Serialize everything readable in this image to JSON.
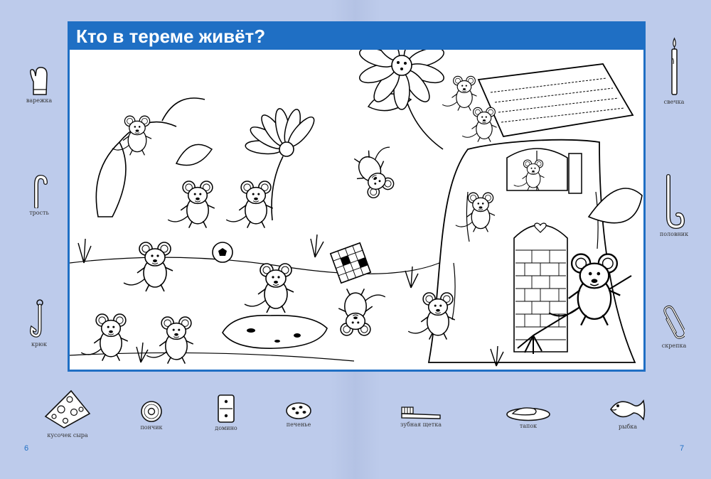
{
  "title": "Кто в тереме живёт?",
  "colors": {
    "page_background": "#bdcbeb",
    "accent": "#1f6fc4",
    "label_text": "#333333"
  },
  "left_items": [
    {
      "label": "варежка",
      "icon": "mitten-icon"
    },
    {
      "label": "трость",
      "icon": "cane-icon"
    },
    {
      "label": "крюк",
      "icon": "hook-icon"
    }
  ],
  "right_items": [
    {
      "label": "свечка",
      "icon": "candle-icon"
    },
    {
      "label": "половник",
      "icon": "ladle-icon"
    },
    {
      "label": "скрепка",
      "icon": "paperclip-icon"
    }
  ],
  "bottom_items": [
    {
      "label": "кусочек сыра",
      "icon": "cheese-slice-icon"
    },
    {
      "label": "пончик",
      "icon": "donut-icon"
    },
    {
      "label": "домино",
      "icon": "domino-icon"
    },
    {
      "label": "печенье",
      "icon": "cookie-icon"
    },
    {
      "label": "зубная щетка",
      "icon": "toothbrush-icon"
    },
    {
      "label": "тапок",
      "icon": "slipper-icon"
    },
    {
      "label": "рыбка",
      "icon": "fish-icon"
    }
  ],
  "page_numbers": {
    "left": "6",
    "right": "7"
  }
}
